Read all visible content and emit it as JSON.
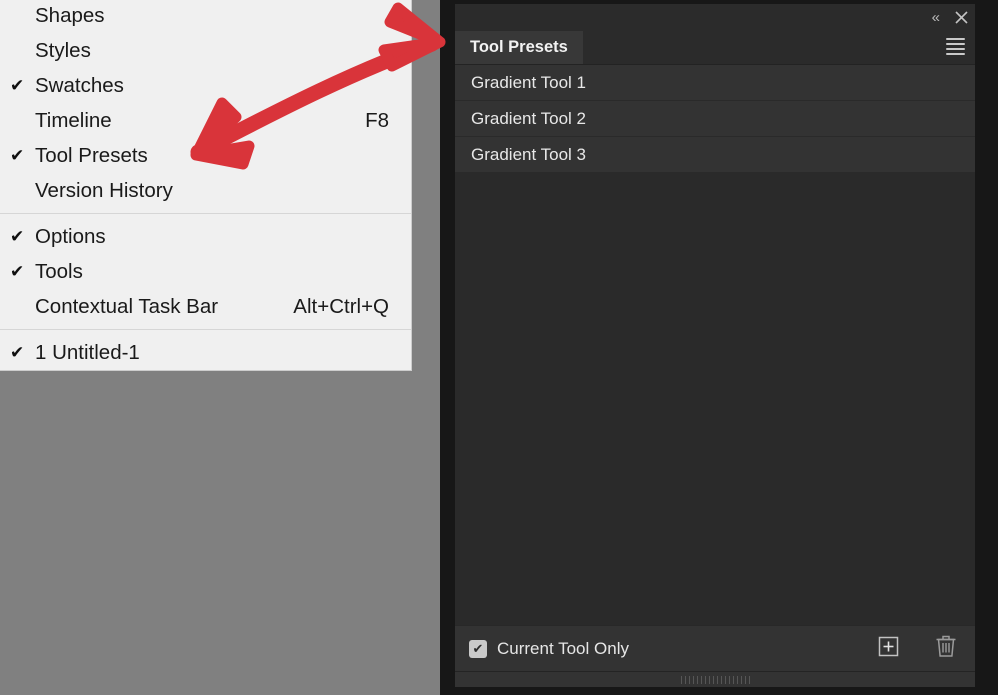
{
  "app": {
    "accent_red": "#d9343a",
    "canvas_color": "#808080",
    "panel_bg": "#2b2b2b",
    "menu_bg": "#f0f0f0"
  },
  "window_menu": {
    "groups": [
      {
        "items": [
          {
            "label": "Shapes",
            "checked": false,
            "accel": ""
          },
          {
            "label": "Styles",
            "checked": false,
            "accel": ""
          },
          {
            "label": "Swatches",
            "checked": true,
            "accel": ""
          },
          {
            "label": "Timeline",
            "checked": false,
            "accel": "F8"
          },
          {
            "label": "Tool Presets",
            "checked": true,
            "accel": ""
          },
          {
            "label": "Version History",
            "checked": false,
            "accel": ""
          }
        ]
      },
      {
        "items": [
          {
            "label": "Options",
            "checked": true,
            "accel": ""
          },
          {
            "label": "Tools",
            "checked": true,
            "accel": ""
          },
          {
            "label": "Contextual Task Bar",
            "checked": false,
            "accel": "Alt+Ctrl+Q"
          }
        ]
      },
      {
        "items": [
          {
            "label": "1 Untitled-1",
            "checked": true,
            "accel": ""
          }
        ]
      }
    ],
    "check_glyph": "✔"
  },
  "panel": {
    "titlebar": {
      "collapse_glyph": "«",
      "close_glyph": "✕",
      "collapse_name": "collapse-to-icons",
      "close_name": "close-panel"
    },
    "tabs": [
      {
        "label": "Tool Presets",
        "active": true
      }
    ],
    "menu_icon_name": "panel-menu-icon",
    "presets": [
      {
        "label": "Gradient Tool 1"
      },
      {
        "label": "Gradient Tool 2"
      },
      {
        "label": "Gradient Tool 3"
      }
    ],
    "footer": {
      "current_tool_only_label": "Current Tool Only",
      "current_tool_only_checked": true,
      "check_glyph": "✔",
      "new_preset_glyph": "+",
      "new_preset_name": "create-new-tool-preset",
      "delete_name": "delete-tool-preset"
    }
  }
}
